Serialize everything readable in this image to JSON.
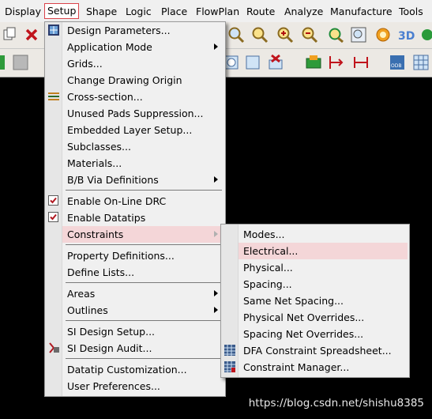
{
  "menubar": {
    "items": [
      "Display",
      "Setup",
      "Shape",
      "Logic",
      "Place",
      "FlowPlan",
      "Route",
      "Analyze",
      "Manufacture",
      "Tools"
    ]
  },
  "setup_menu": {
    "items": [
      "Design Parameters...",
      "Application Mode",
      "Grids...",
      "Change Drawing Origin",
      "Cross-section...",
      "Unused Pads Suppression...",
      "Embedded Layer Setup...",
      "Subclasses...",
      "Materials...",
      "B/B Via Definitions",
      "Enable On-Line DRC",
      "Enable Datatips",
      "Constraints",
      "Property Definitions...",
      "Define Lists...",
      "Areas",
      "Outlines",
      "SI Design Setup...",
      "SI Design Audit...",
      "Datatip Customization...",
      "User Preferences..."
    ],
    "checked": {
      "drc": true,
      "datatips": true
    }
  },
  "constraints_submenu": {
    "items": [
      "Modes...",
      "Electrical...",
      "Physical...",
      "Spacing...",
      "Same Net Spacing...",
      "Physical Net Overrides...",
      "Spacing Net Overrides...",
      "DFA Constraint Spreadsheet...",
      "Constraint Manager..."
    ]
  },
  "watermark": "https://blog.csdn.net/shishu8385",
  "colors": {
    "highlight": "#f4d6d8",
    "active_border": "#d9434a",
    "canvas": "#000000"
  }
}
